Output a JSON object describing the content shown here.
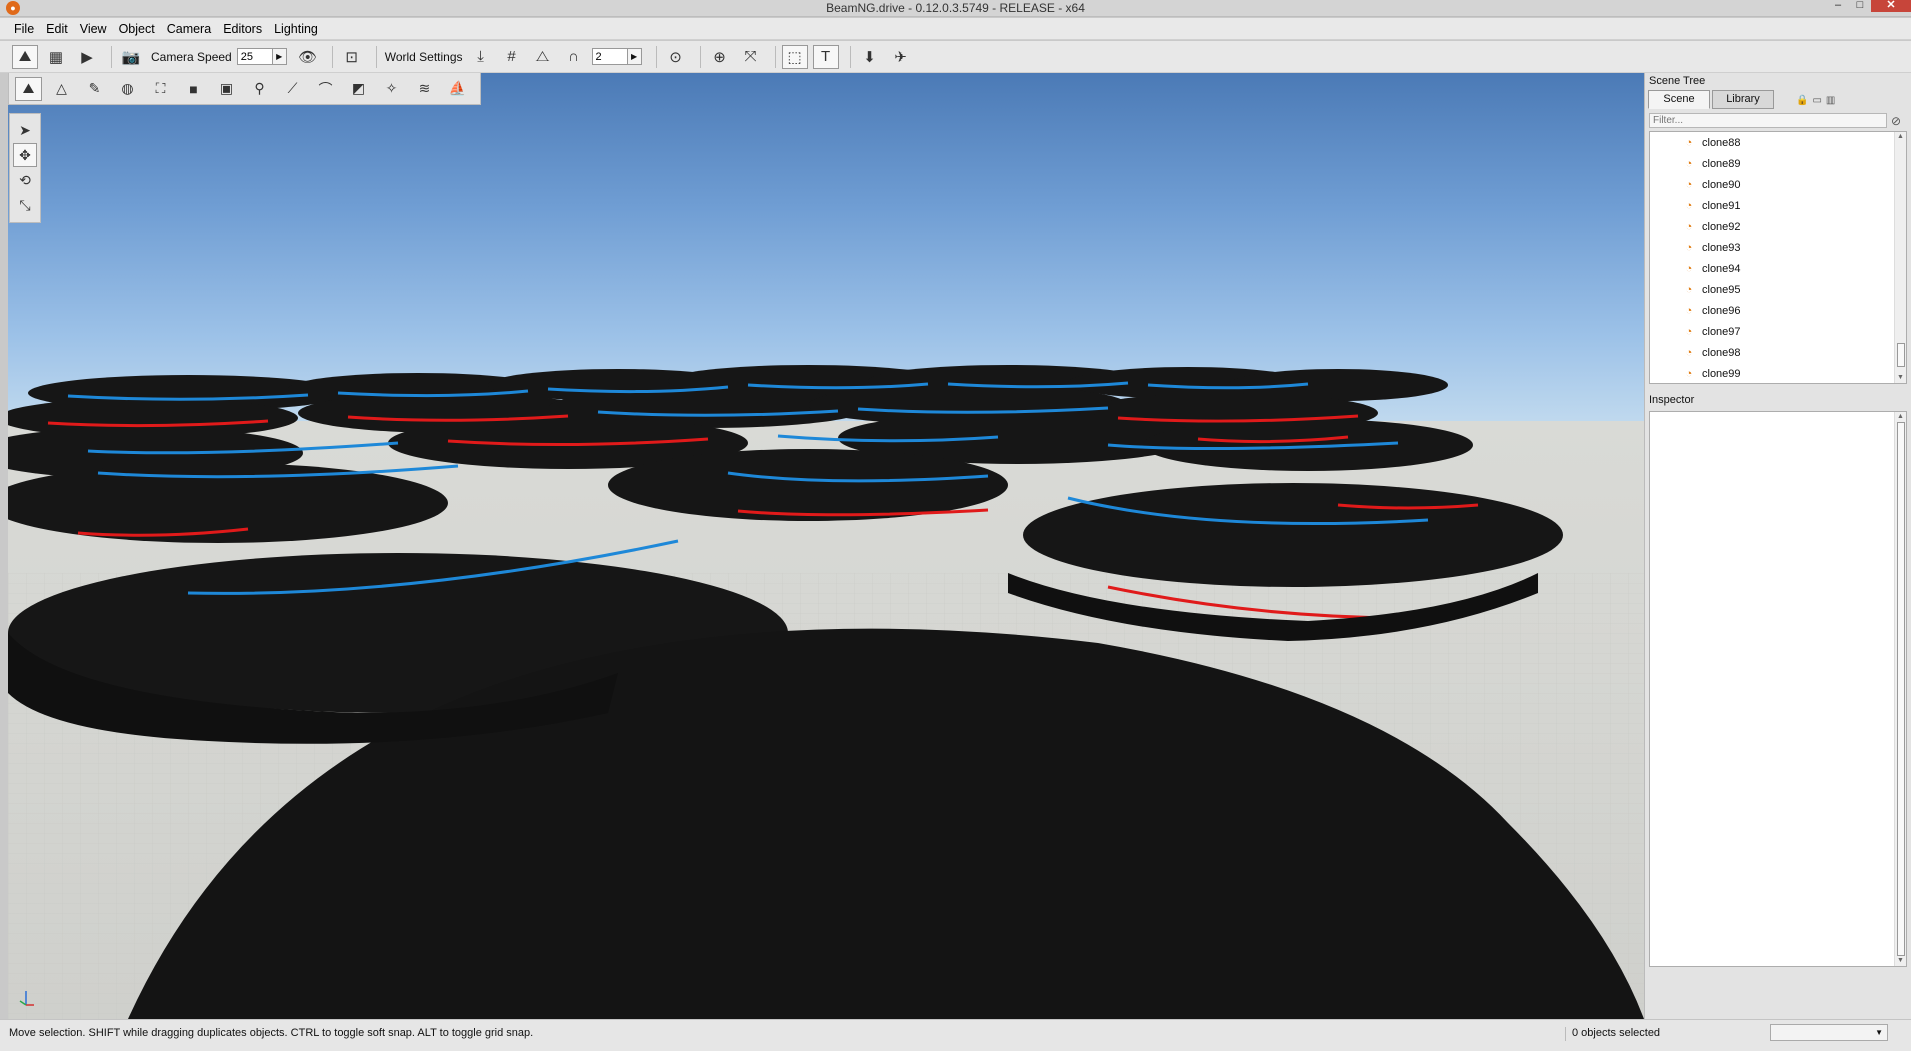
{
  "window": {
    "title": "BeamNG.drive - 0.12.0.3.5749 - RELEASE - x64"
  },
  "menu": [
    "File",
    "Edit",
    "View",
    "Object",
    "Camera",
    "Editors",
    "Lighting"
  ],
  "toolbar": {
    "camera_speed_label": "Camera Speed",
    "camera_speed_value": "25",
    "world_settings_label": "World Settings",
    "grid_value": "2"
  },
  "scene_tree": {
    "title": "Scene Tree",
    "tabs": [
      "Scene",
      "Library"
    ],
    "active_tab": "Scene",
    "filter_placeholder": "Filter...",
    "items": [
      "clone88",
      "clone89",
      "clone90",
      "clone91",
      "clone92",
      "clone93",
      "clone94",
      "clone95",
      "clone96",
      "clone97",
      "clone98",
      "clone99"
    ]
  },
  "inspector": {
    "title": "Inspector"
  },
  "status": {
    "hint": "Move selection.  SHIFT while dragging duplicates objects.  CTRL to toggle soft snap.  ALT to toggle grid snap.",
    "selection": "0 objects selected"
  },
  "colors": {
    "blue_ring": "#1e88d8",
    "red_ring": "#e01a1a",
    "disc": "#151515"
  }
}
